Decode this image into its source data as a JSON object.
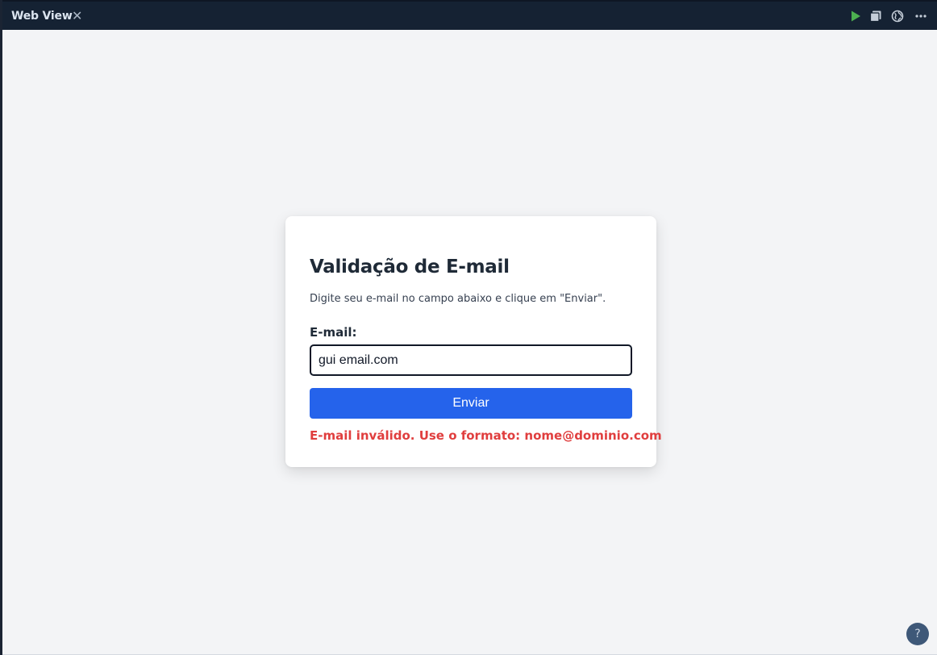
{
  "window": {
    "tab_title": "Web View",
    "close_glyph": "✕",
    "toolbar": {
      "icons": [
        "play-icon",
        "window-stack-icon",
        "globe-icon",
        "more-icon"
      ],
      "play_color": "#4caf50"
    }
  },
  "form": {
    "title": "Validação de E-mail",
    "description": "Digite seu e-mail no campo abaixo e clique em \"Enviar\".",
    "email_label": "E-mail:",
    "email_value": "gui email.com",
    "submit_label": "Enviar",
    "error_message": "E-mail inválido. Use o formato: nome@dominio.com"
  },
  "help": {
    "glyph": "?"
  },
  "colors": {
    "button": "#2563eb",
    "error": "#e03e3e",
    "titlebar": "#152233",
    "background": "#f3f4f6"
  }
}
